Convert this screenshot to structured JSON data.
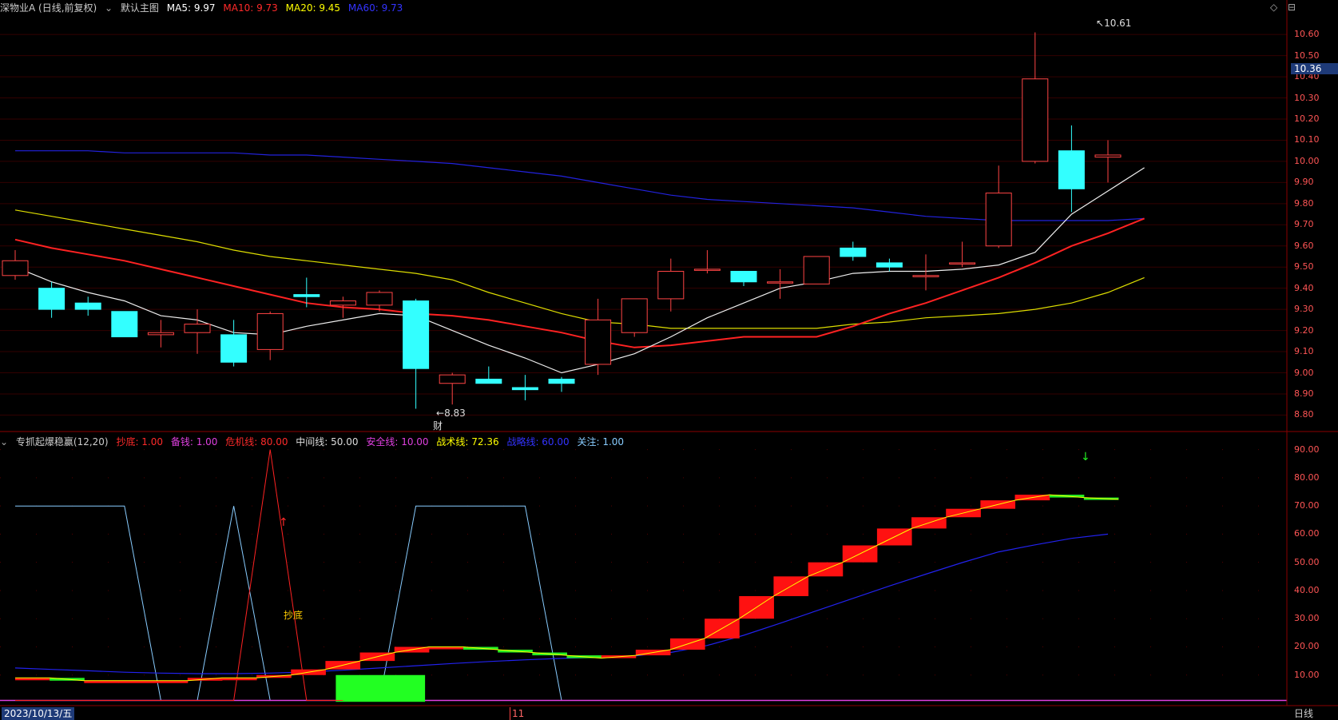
{
  "price_panel": {
    "stock_label": "深物业A (日线,前复权)",
    "theme_label": "默认主图",
    "indicators": [
      {
        "label": "MA5: 9.97",
        "color": "#ffffff"
      },
      {
        "label": "MA10: 9.73",
        "color": "#ff2a2a"
      },
      {
        "label": "MA20: 9.45",
        "color": "#ffff00"
      },
      {
        "label": "MA60: 9.73",
        "color": "#2222ff"
      }
    ],
    "current_price": "10.36",
    "high_label": "10.61",
    "low_label": "8.83",
    "event_marker": "财",
    "y_ticks": [
      "10.60",
      "10.50",
      "10.40",
      "10.30",
      "10.20",
      "10.10",
      "10.00",
      "9.90",
      "9.80",
      "9.70",
      "9.60",
      "9.50",
      "9.40",
      "9.30",
      "9.20",
      "9.10",
      "9.00",
      "8.90",
      "8.80"
    ]
  },
  "indicator_panel": {
    "name": "专抓起爆稳赢(12,20)",
    "lines": [
      {
        "label": "抄底: 1.00",
        "color": "#ff2a2a"
      },
      {
        "label": "备钱: 1.00",
        "color": "#e040e0"
      },
      {
        "label": "危机线: 80.00",
        "color": "#ff2a2a"
      },
      {
        "label": "中间线: 50.00",
        "color": "#dddddd"
      },
      {
        "label": "安全线: 10.00",
        "color": "#e040e0"
      },
      {
        "label": "战术线: 72.36",
        "color": "#ffff00"
      },
      {
        "label": "战略线: 60.00",
        "color": "#2222ff"
      },
      {
        "label": "关注: 1.00",
        "color": "#88ccff"
      }
    ],
    "y_ticks": [
      "90.00",
      "80.00",
      "70.00",
      "60.00",
      "50.00",
      "40.00",
      "30.00",
      "20.00",
      "10.00"
    ],
    "signal_text": "抄底"
  },
  "bottom_bar": {
    "date": "2023/10/13/五",
    "month_marker": "11",
    "period": "日线"
  },
  "chart_data": {
    "type": "candlestick",
    "ohlc": [
      [
        9.46,
        9.58,
        9.44,
        9.53
      ],
      [
        9.4,
        9.43,
        9.26,
        9.3
      ],
      [
        9.33,
        9.36,
        9.27,
        9.3
      ],
      [
        9.29,
        9.29,
        9.17,
        9.17
      ],
      [
        9.18,
        9.25,
        9.12,
        9.19
      ],
      [
        9.19,
        9.3,
        9.09,
        9.23
      ],
      [
        9.18,
        9.25,
        9.03,
        9.05
      ],
      [
        9.11,
        9.29,
        9.06,
        9.28
      ],
      [
        9.37,
        9.45,
        9.31,
        9.36
      ],
      [
        9.32,
        9.36,
        9.26,
        9.34
      ],
      [
        9.32,
        9.39,
        9.29,
        9.38
      ],
      [
        9.34,
        9.35,
        8.83,
        9.02
      ],
      [
        8.95,
        9.0,
        8.85,
        8.99
      ],
      [
        8.97,
        9.03,
        8.95,
        8.95
      ],
      [
        8.93,
        8.99,
        8.87,
        8.92
      ],
      [
        8.97,
        8.98,
        8.91,
        8.95
      ],
      [
        9.04,
        9.35,
        8.99,
        9.25
      ],
      [
        9.19,
        9.31,
        9.17,
        9.35
      ],
      [
        9.35,
        9.54,
        9.29,
        9.48
      ],
      [
        9.49,
        9.58,
        9.47,
        9.49
      ],
      [
        9.48,
        9.48,
        9.41,
        9.43
      ],
      [
        9.43,
        9.49,
        9.35,
        9.43
      ],
      [
        9.42,
        9.55,
        9.42,
        9.55
      ],
      [
        9.59,
        9.62,
        9.53,
        9.55
      ],
      [
        9.52,
        9.54,
        9.48,
        9.5
      ],
      [
        9.46,
        9.56,
        9.39,
        9.46
      ],
      [
        9.52,
        9.62,
        9.5,
        9.52
      ],
      [
        9.6,
        9.98,
        9.59,
        9.85
      ],
      [
        10.0,
        10.61,
        9.99,
        10.39
      ],
      [
        10.05,
        10.17,
        9.76,
        9.87
      ],
      [
        10.02,
        10.1,
        9.9,
        10.03
      ]
    ],
    "ma": {
      "MA5": [
        9.5,
        9.43,
        9.38,
        9.34,
        9.27,
        9.25,
        9.19,
        9.18,
        9.22,
        9.25,
        9.28,
        9.27,
        9.2,
        9.13,
        9.07,
        9.0,
        9.04,
        9.09,
        9.17,
        9.26,
        9.33,
        9.4,
        9.43,
        9.47,
        9.48,
        9.48,
        9.49,
        9.51,
        9.57,
        9.75,
        9.86,
        9.97
      ],
      "MA10": [
        9.63,
        9.59,
        9.56,
        9.53,
        9.49,
        9.45,
        9.41,
        9.37,
        9.33,
        9.31,
        9.3,
        9.28,
        9.27,
        9.25,
        9.22,
        9.19,
        9.15,
        9.12,
        9.13,
        9.15,
        9.17,
        9.17,
        9.17,
        9.22,
        9.28,
        9.33,
        9.39,
        9.45,
        9.52,
        9.6,
        9.66,
        9.73
      ],
      "MA20": [
        9.77,
        9.74,
        9.71,
        9.68,
        9.65,
        9.62,
        9.58,
        9.55,
        9.53,
        9.51,
        9.49,
        9.47,
        9.44,
        9.38,
        9.33,
        9.28,
        9.24,
        9.23,
        9.21,
        9.21,
        9.21,
        9.21,
        9.21,
        9.23,
        9.24,
        9.26,
        9.27,
        9.28,
        9.3,
        9.33,
        9.38,
        9.45
      ],
      "MA60": [
        10.05,
        10.05,
        10.05,
        10.04,
        10.04,
        10.04,
        10.04,
        10.03,
        10.03,
        10.02,
        10.01,
        10.0,
        9.99,
        9.97,
        9.95,
        9.93,
        9.9,
        9.87,
        9.84,
        9.82,
        9.81,
        9.8,
        9.79,
        9.78,
        9.76,
        9.74,
        9.73,
        9.72,
        9.72,
        9.72,
        9.72,
        9.73
      ]
    },
    "y_range": [
      8.76,
      10.68
    ],
    "indicator": {
      "y_range": [
        0,
        95
      ],
      "tactical": [
        9,
        9,
        8,
        8,
        8,
        8,
        9,
        9,
        10,
        12,
        15,
        18,
        20,
        20,
        19,
        18,
        17,
        16,
        17,
        19,
        23,
        30,
        38,
        45,
        50,
        56,
        62,
        66,
        69,
        72,
        74,
        73,
        72.36
      ],
      "strategic": [
        12.5,
        12,
        11.5,
        11,
        10.7,
        10.5,
        10.5,
        10.7,
        11.1,
        11.7,
        12.5,
        13.3,
        14.1,
        14.8,
        15.4,
        15.9,
        16.3,
        16.8,
        18,
        20.5,
        24.1,
        28.4,
        32.8,
        37.2,
        41.6,
        45.8,
        49.9,
        53.7,
        56.2,
        58.5,
        60
      ],
      "attention": [
        70,
        70,
        70,
        70,
        1,
        1,
        70,
        1,
        1,
        1,
        1,
        70,
        70,
        70,
        70,
        1,
        1,
        1,
        1,
        1,
        1,
        1,
        1,
        1,
        1,
        1,
        1,
        1,
        1,
        1,
        1
      ],
      "danger_spike": [
        1,
        1,
        1,
        1,
        1,
        1,
        1,
        90,
        1,
        1
      ],
      "bottom_bar_value": 10,
      "safety_line": 1
    }
  }
}
